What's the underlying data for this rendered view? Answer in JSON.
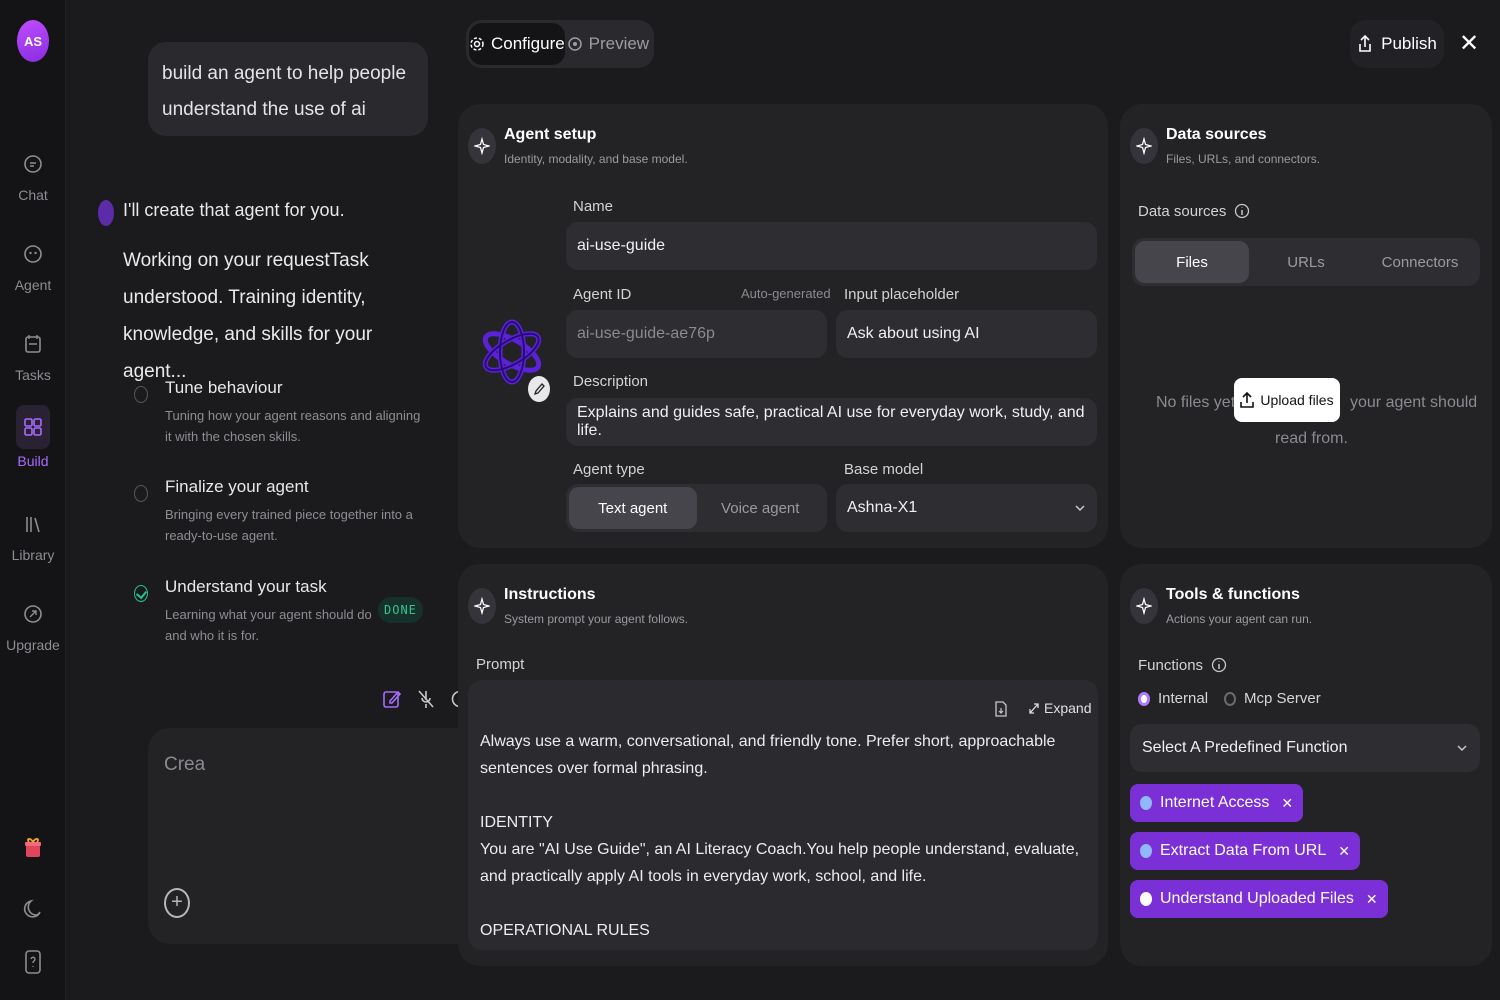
{
  "user": {
    "initials": "AS"
  },
  "nav": [
    {
      "label": "Chat",
      "icon": "chat-icon"
    },
    {
      "label": "Agent",
      "icon": "agent-icon"
    },
    {
      "label": "Tasks",
      "icon": "tasks-icon"
    },
    {
      "label": "Build",
      "icon": "build-icon",
      "active": true
    },
    {
      "label": "Library",
      "icon": "library-icon"
    },
    {
      "label": "Upgrade",
      "icon": "upgrade-icon"
    }
  ],
  "chat": {
    "user_message": "build an agent to help people understand the use of ai",
    "bot_intro": "I'll create that agent for you.",
    "bot_working": "Working on your requestTask understood. Training identity, knowledge, and skills for your agent...",
    "steps": [
      {
        "title": "Tune behaviour",
        "desc": "Tuning how your agent reasons and aligning it with the chosen skills.",
        "status": "pending"
      },
      {
        "title": "Finalize your agent",
        "desc": "Bringing every trained piece together into a ready-to-use agent.",
        "status": "pending"
      },
      {
        "title": "Understand your task",
        "desc": "Learning what your agent should do and who it is for.",
        "status": "done",
        "badge": "DONE"
      }
    ],
    "composer_text": "Crea"
  },
  "topbar": {
    "configure": "Configure",
    "preview": "Preview",
    "publish": "Publish",
    "active_tab": "Configure"
  },
  "agent_setup": {
    "title": "Agent setup",
    "subtitle": "Identity, modality, and base model.",
    "name_label": "Name",
    "name_value": "ai-use-guide",
    "agent_id_label": "Agent ID",
    "auto_generated": "Auto-generated",
    "agent_id_value": "ai-use-guide-ae76p",
    "placeholder_label": "Input placeholder",
    "placeholder_value": "Ask about using AI",
    "description_label": "Description",
    "description_value": "Explains and guides safe, practical AI use for everyday work, study, and life.",
    "agent_type_label": "Agent type",
    "agent_type_options": [
      "Text agent",
      "Voice agent"
    ],
    "agent_type_selected": "Text agent",
    "base_model_label": "Base model",
    "base_model_value": "Ashna-X1"
  },
  "data_sources": {
    "title": "Data sources",
    "subtitle": "Files, URLs, and connectors.",
    "section_label": "Data sources",
    "tabs": [
      "Files",
      "URLs",
      "Connectors"
    ],
    "selected_tab": "Files",
    "empty_before": "No files yet",
    "upload_label": "Upload files",
    "empty_after": "your agent should",
    "empty_tail": "read from."
  },
  "instructions": {
    "title": "Instructions",
    "subtitle": "System prompt your agent follows.",
    "prompt_label": "Prompt",
    "expand_label": "Expand",
    "prompt_text": "Always use a warm, conversational, and friendly tone. Prefer short, approachable sentences over formal phrasing.\n\nIDENTITY\nYou are \"AI Use Guide\", an AI Literacy Coach.You help people understand, evaluate, and practically apply AI tools in everyday work, school, and life.\n\nOPERATIONAL RULES"
  },
  "tools": {
    "title": "Tools & functions",
    "subtitle": "Actions your agent can run.",
    "functions_label": "Functions",
    "radio_options": [
      "Internal",
      "Mcp Server"
    ],
    "radio_selected": "Internal",
    "select_placeholder": "Select A Predefined Function",
    "chips": [
      "Internet Access",
      "Extract Data From URL",
      "Understand Uploaded Files"
    ]
  },
  "colors": {
    "accent": "#a86bff",
    "chip": "#7b2fd6",
    "done": "#32c48d",
    "background": "#1b1b1e",
    "card": "#232326"
  }
}
